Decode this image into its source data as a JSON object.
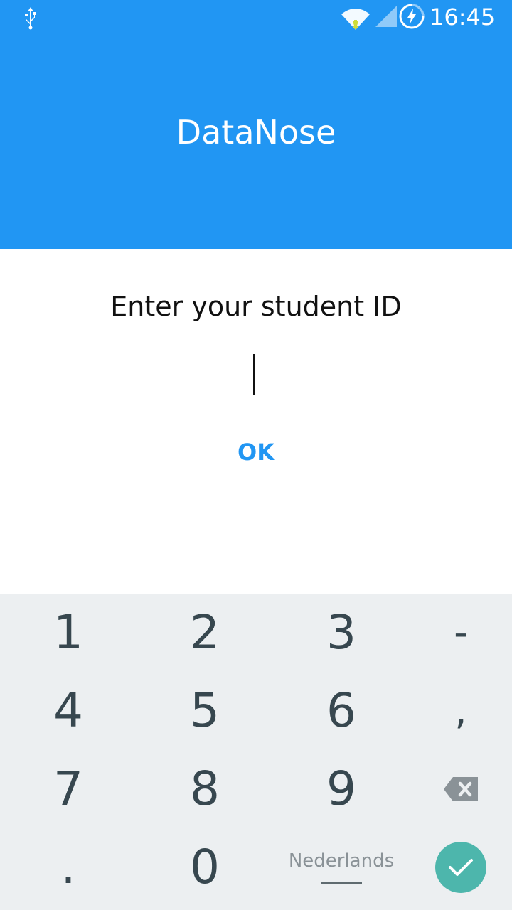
{
  "status_bar": {
    "time": "16:45",
    "icons": [
      "usb-icon",
      "wifi-icon",
      "signal-icon",
      "battery-charging-icon"
    ]
  },
  "header": {
    "title": "DataNose"
  },
  "form": {
    "prompt": "Enter your student ID",
    "input_value": "",
    "ok_label": "OK"
  },
  "keyboard": {
    "rows": [
      [
        "1",
        "2",
        "3",
        "-"
      ],
      [
        "4",
        "5",
        "6",
        ","
      ],
      [
        "7",
        "8",
        "9",
        "backspace-icon"
      ],
      [
        ".",
        "0",
        "Nederlands",
        "done-icon"
      ]
    ],
    "keys": {
      "k1": "1",
      "k2": "2",
      "k3": "3",
      "dash": "-",
      "k4": "4",
      "k5": "5",
      "k6": "6",
      "comma": ",",
      "k7": "7",
      "k8": "8",
      "k9": "9",
      "period": ".",
      "k0": "0",
      "language": "Nederlands"
    }
  },
  "colors": {
    "accent": "#2196F3",
    "keyboard_bg": "#ECEFF1",
    "key_text": "#37474F",
    "done_button": "#4DB6AC"
  }
}
